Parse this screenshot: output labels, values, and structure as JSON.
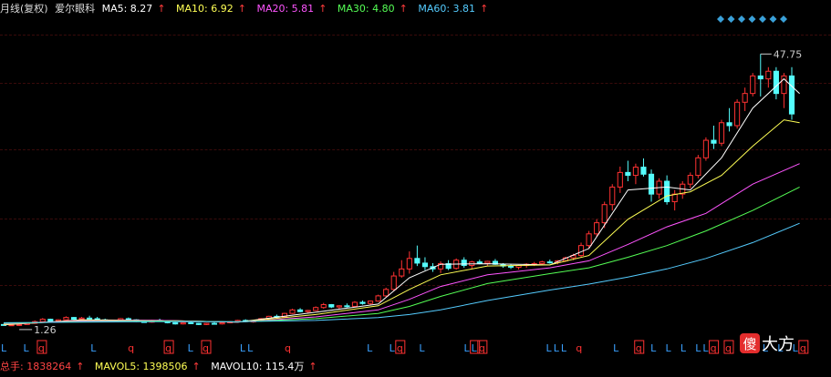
{
  "header": {
    "period_label": "月线(复权)",
    "stock_name": "爱尔眼科",
    "ma": [
      {
        "label": "MA5: 8.27",
        "color": "#ffffff"
      },
      {
        "label": "MA10: 6.92",
        "color": "#ffff55"
      },
      {
        "label": "MA20: 5.81",
        "color": "#ff55ff"
      },
      {
        "label": "MA30: 4.80",
        "color": "#55ff55"
      },
      {
        "label": "MA60: 3.81",
        "color": "#55ccff"
      }
    ],
    "arrow": "↑"
  },
  "chart_data": {
    "type": "candlestick",
    "high_label": "47.75",
    "low_label": "1.26",
    "ylim": [
      0,
      52
    ],
    "candles": [
      [
        1.5,
        1.6,
        1.3,
        1.4
      ],
      [
        1.4,
        1.5,
        1.3,
        1.45
      ],
      [
        1.45,
        1.6,
        1.26,
        1.5
      ],
      [
        1.5,
        1.8,
        1.45,
        1.7
      ],
      [
        1.7,
        2.2,
        1.6,
        2.0
      ],
      [
        2.0,
        2.6,
        1.9,
        2.4
      ],
      [
        2.4,
        2.5,
        2.0,
        2.1
      ],
      [
        2.1,
        2.4,
        1.9,
        2.3
      ],
      [
        2.3,
        2.9,
        2.2,
        2.7
      ],
      [
        2.7,
        2.8,
        2.3,
        2.4
      ],
      [
        2.4,
        2.8,
        2.3,
        2.6
      ],
      [
        2.6,
        3.0,
        2.4,
        2.5
      ],
      [
        2.5,
        2.8,
        2.2,
        2.3
      ],
      [
        2.3,
        2.5,
        2.0,
        2.1
      ],
      [
        2.1,
        2.3,
        1.9,
        2.2
      ],
      [
        2.2,
        2.6,
        2.1,
        2.5
      ],
      [
        2.5,
        2.7,
        2.2,
        2.3
      ],
      [
        2.3,
        2.4,
        1.9,
        2.0
      ],
      [
        2.0,
        2.2,
        1.8,
        1.9
      ],
      [
        1.9,
        2.3,
        1.8,
        2.2
      ],
      [
        2.2,
        2.5,
        2.0,
        2.1
      ],
      [
        2.1,
        2.2,
        1.7,
        1.8
      ],
      [
        1.8,
        1.9,
        1.5,
        1.6
      ],
      [
        1.6,
        1.9,
        1.5,
        1.8
      ],
      [
        1.8,
        2.0,
        1.6,
        1.7
      ],
      [
        1.7,
        1.8,
        1.4,
        1.5
      ],
      [
        1.5,
        1.8,
        1.4,
        1.7
      ],
      [
        1.7,
        1.9,
        1.5,
        1.6
      ],
      [
        1.6,
        1.9,
        1.5,
        1.8
      ],
      [
        1.8,
        2.1,
        1.7,
        2.0
      ],
      [
        2.0,
        2.3,
        1.9,
        2.2
      ],
      [
        2.2,
        2.4,
        1.9,
        2.0
      ],
      [
        2.0,
        2.2,
        1.8,
        2.1
      ],
      [
        2.1,
        2.6,
        2.0,
        2.5
      ],
      [
        2.5,
        3.0,
        2.4,
        2.9
      ],
      [
        2.9,
        3.2,
        2.6,
        2.8
      ],
      [
        2.8,
        3.5,
        2.7,
        3.4
      ],
      [
        3.4,
        4.2,
        3.3,
        4.0
      ],
      [
        4.0,
        4.3,
        3.6,
        3.7
      ],
      [
        3.7,
        4.0,
        3.4,
        3.9
      ],
      [
        3.9,
        4.6,
        3.8,
        4.4
      ],
      [
        4.4,
        5.2,
        4.2,
        4.9
      ],
      [
        4.9,
        5.0,
        4.3,
        4.5
      ],
      [
        4.5,
        4.8,
        4.1,
        4.7
      ],
      [
        4.7,
        5.1,
        4.4,
        4.6
      ],
      [
        4.6,
        5.5,
        4.5,
        5.3
      ],
      [
        5.3,
        5.6,
        4.9,
        5.1
      ],
      [
        5.1,
        5.6,
        4.9,
        5.5
      ],
      [
        5.5,
        6.6,
        5.4,
        6.4
      ],
      [
        6.4,
        7.8,
        6.2,
        7.5
      ],
      [
        7.5,
        10.5,
        7.2,
        9.8
      ],
      [
        9.8,
        12.5,
        9.5,
        11.0
      ],
      [
        11.0,
        14.0,
        10.2,
        12.8
      ],
      [
        12.8,
        15.0,
        11.5,
        12.0
      ],
      [
        12.0,
        13.0,
        10.8,
        11.4
      ],
      [
        11.4,
        12.0,
        10.5,
        11.0
      ],
      [
        11.0,
        12.3,
        10.3,
        11.9
      ],
      [
        11.9,
        12.5,
        10.8,
        11.1
      ],
      [
        11.1,
        12.8,
        10.9,
        12.5
      ],
      [
        12.5,
        13.0,
        11.2,
        11.6
      ],
      [
        11.6,
        12.4,
        11.0,
        12.2
      ],
      [
        12.2,
        12.6,
        11.8,
        12.0
      ],
      [
        12.0,
        12.4,
        11.5,
        12.3
      ],
      [
        12.3,
        12.7,
        11.7,
        11.8
      ],
      [
        11.8,
        12.0,
        11.2,
        11.5
      ],
      [
        11.5,
        11.8,
        11.0,
        11.3
      ],
      [
        11.3,
        11.7,
        10.9,
        11.6
      ],
      [
        11.6,
        12.0,
        11.2,
        11.8
      ],
      [
        11.8,
        12.2,
        11.5,
        11.9
      ],
      [
        11.9,
        12.4,
        11.6,
        12.2
      ],
      [
        12.2,
        12.6,
        11.9,
        12.1
      ],
      [
        12.1,
        12.5,
        11.8,
        12.4
      ],
      [
        12.4,
        13.1,
        12.2,
        12.9
      ],
      [
        12.9,
        13.6,
        12.5,
        13.3
      ],
      [
        13.3,
        15.5,
        13.0,
        15.0
      ],
      [
        15.0,
        17.5,
        14.5,
        17.0
      ],
      [
        17.0,
        19.5,
        16.5,
        18.9
      ],
      [
        18.9,
        22.5,
        18.0,
        22.0
      ],
      [
        22.0,
        25.5,
        21.0,
        25.0
      ],
      [
        25.0,
        28.5,
        24.0,
        27.5
      ],
      [
        27.5,
        29.5,
        26.0,
        27.0
      ],
      [
        27.0,
        29.0,
        25.5,
        28.4
      ],
      [
        28.4,
        29.9,
        26.8,
        27.2
      ],
      [
        27.2,
        28.0,
        22.5,
        23.8
      ],
      [
        23.8,
        26.5,
        23.0,
        26.0
      ],
      [
        26.0,
        27.0,
        22.0,
        22.5
      ],
      [
        22.5,
        24.5,
        21.0,
        23.8
      ],
      [
        23.8,
        26.0,
        23.0,
        25.5
      ],
      [
        25.5,
        27.5,
        24.8,
        27.0
      ],
      [
        27.0,
        30.5,
        26.5,
        30.0
      ],
      [
        30.0,
        33.5,
        29.5,
        33.0
      ],
      [
        33.0,
        35.5,
        31.5,
        32.5
      ],
      [
        32.5,
        36.5,
        32.0,
        36.0
      ],
      [
        36.0,
        38.5,
        34.5,
        35.5
      ],
      [
        35.5,
        40.0,
        35.0,
        39.5
      ],
      [
        39.5,
        42.0,
        38.0,
        41.0
      ],
      [
        41.0,
        44.5,
        40.5,
        44.0
      ],
      [
        44.0,
        47.75,
        40.5,
        43.5
      ],
      [
        43.5,
        45.5,
        42.0,
        44.8
      ],
      [
        44.8,
        45.5,
        40.0,
        41.0
      ],
      [
        41.0,
        44.5,
        38.5,
        44.0
      ],
      [
        44.0,
        45.5,
        36.5,
        37.5
      ]
    ],
    "ma_lines": [
      {
        "name": "MA5",
        "color": "#ffffff",
        "points": [
          [
            0,
            1.45
          ],
          [
            10,
            2.3
          ],
          [
            20,
            2.2
          ],
          [
            30,
            1.9
          ],
          [
            40,
            3.6
          ],
          [
            48,
            5.0
          ],
          [
            52,
            9.5
          ],
          [
            56,
            11.8
          ],
          [
            62,
            11.9
          ],
          [
            70,
            11.7
          ],
          [
            75,
            14.5
          ],
          [
            80,
            24.5
          ],
          [
            85,
            25.0
          ],
          [
            88,
            24.5
          ],
          [
            92,
            30.0
          ],
          [
            96,
            38.5
          ],
          [
            100,
            43.5
          ],
          [
            102,
            41.0
          ]
        ]
      },
      {
        "name": "MA10",
        "color": "#ffff55",
        "points": [
          [
            0,
            1.5
          ],
          [
            10,
            2.2
          ],
          [
            20,
            2.2
          ],
          [
            30,
            1.9
          ],
          [
            40,
            3.2
          ],
          [
            48,
            4.7
          ],
          [
            52,
            7.5
          ],
          [
            56,
            10.0
          ],
          [
            62,
            11.5
          ],
          [
            70,
            11.7
          ],
          [
            75,
            13.3
          ],
          [
            80,
            19.5
          ],
          [
            85,
            23.5
          ],
          [
            88,
            24.2
          ],
          [
            92,
            27.0
          ],
          [
            96,
            32.0
          ],
          [
            100,
            36.5
          ],
          [
            102,
            36.0
          ]
        ]
      },
      {
        "name": "MA20",
        "color": "#ff55ff",
        "points": [
          [
            0,
            1.6
          ],
          [
            10,
            2.1
          ],
          [
            20,
            2.2
          ],
          [
            30,
            1.9
          ],
          [
            40,
            2.8
          ],
          [
            48,
            4.0
          ],
          [
            52,
            5.8
          ],
          [
            56,
            8.0
          ],
          [
            62,
            10.0
          ],
          [
            70,
            11.2
          ],
          [
            75,
            12.4
          ],
          [
            80,
            15.2
          ],
          [
            85,
            18.2
          ],
          [
            90,
            20.5
          ],
          [
            96,
            25.5
          ],
          [
            102,
            29.0
          ]
        ]
      },
      {
        "name": "MA30",
        "color": "#55ff55",
        "points": [
          [
            0,
            1.7
          ],
          [
            10,
            2.0
          ],
          [
            20,
            2.1
          ],
          [
            30,
            1.95
          ],
          [
            40,
            2.5
          ],
          [
            48,
            3.4
          ],
          [
            52,
            4.6
          ],
          [
            56,
            6.3
          ],
          [
            62,
            8.5
          ],
          [
            70,
            10.2
          ],
          [
            75,
            11.2
          ],
          [
            80,
            13.0
          ],
          [
            85,
            15.0
          ],
          [
            90,
            17.5
          ],
          [
            96,
            21.0
          ],
          [
            102,
            25.0
          ]
        ]
      },
      {
        "name": "MA60",
        "color": "#55ccff",
        "points": [
          [
            0,
            1.8
          ],
          [
            10,
            1.9
          ],
          [
            20,
            2.0
          ],
          [
            30,
            2.0
          ],
          [
            40,
            2.2
          ],
          [
            48,
            2.7
          ],
          [
            52,
            3.2
          ],
          [
            56,
            4.0
          ],
          [
            62,
            5.6
          ],
          [
            70,
            7.4
          ],
          [
            75,
            8.4
          ],
          [
            80,
            9.6
          ],
          [
            85,
            11.0
          ],
          [
            90,
            12.8
          ],
          [
            96,
            15.5
          ],
          [
            102,
            18.8
          ]
        ]
      }
    ],
    "signal_marks": [
      {
        "i": 0,
        "t": "L"
      },
      {
        "i": 3,
        "t": "L"
      },
      {
        "i": 5,
        "t": "q",
        "box": true
      },
      {
        "i": 12,
        "t": "L"
      },
      {
        "i": 17,
        "t": "q"
      },
      {
        "i": 22,
        "t": "q",
        "box": true
      },
      {
        "i": 25,
        "t": "L"
      },
      {
        "i": 27,
        "t": "q",
        "box": true
      },
      {
        "i": 32,
        "t": "L"
      },
      {
        "i": 33,
        "t": "L"
      },
      {
        "i": 38,
        "t": "q"
      },
      {
        "i": 49,
        "t": "L"
      },
      {
        "i": 52,
        "t": "L"
      },
      {
        "i": 53,
        "t": "q",
        "box": true
      },
      {
        "i": 56,
        "t": "L"
      },
      {
        "i": 62,
        "t": "L"
      },
      {
        "i": 63,
        "t": "L",
        "box": true
      },
      {
        "i": 64,
        "t": "q",
        "box": true
      },
      {
        "i": 73,
        "t": "L"
      },
      {
        "i": 74,
        "t": "L"
      },
      {
        "i": 75,
        "t": "L"
      },
      {
        "i": 77,
        "t": "q"
      },
      {
        "i": 82,
        "t": "L"
      },
      {
        "i": 85,
        "t": "q",
        "box": true
      },
      {
        "i": 87,
        "t": "L"
      },
      {
        "i": 89,
        "t": "L"
      },
      {
        "i": 91,
        "t": "L"
      },
      {
        "i": 93,
        "t": "L"
      },
      {
        "i": 94,
        "t": "L"
      },
      {
        "i": 95,
        "t": "q",
        "box": true
      },
      {
        "i": 97,
        "t": "q",
        "box": true
      },
      {
        "i": 100,
        "t": "L"
      },
      {
        "i": 102,
        "t": "L"
      },
      {
        "i": 104,
        "t": "L"
      },
      {
        "i": 106,
        "t": "L"
      },
      {
        "i": 107,
        "t": "q",
        "box": true
      }
    ],
    "diamond_count": 7
  },
  "volume": {
    "total_label": "总手: 1838264",
    "mavol5_label": "MAVOL5: 1398506",
    "mavol10_label": "MAVOL10: 115.4万",
    "arrow": "↑"
  },
  "watermark": {
    "logo_glyph": "傻",
    "text": "大方"
  }
}
